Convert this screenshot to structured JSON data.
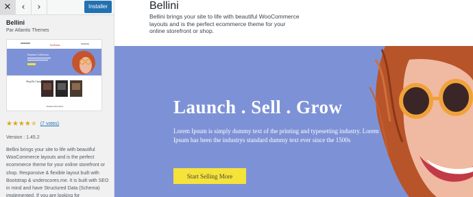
{
  "sidebar": {
    "close_icon": "close-icon",
    "prev_icon": "chevron-left-icon",
    "next_icon": "chevron-right-icon",
    "install_label": "Installer",
    "theme_name": "Bellini",
    "theme_author": "Par Atlantis Themes",
    "thumbnail": {
      "brand": "Azeleena",
      "hero_title": "Summer Collection",
      "category_title": "Shop By Category",
      "featured_title": "Featured Products"
    },
    "rating": {
      "stars": 4.5,
      "votes_label": "(7 votes)"
    },
    "version_label": "Version : 1.45.2",
    "description": "Bellini brings your site to life with beautiful WooCommerce layouts and is the perfect ecommerce theme for your online storefront or shop. Responsive & flexible layout built with Bootstrap & underscores.me. It is built with SEO in mind and have Structured Data (Schema) implemented. If you are looking for"
  },
  "preview": {
    "title": "Bellini",
    "description": "Bellini brings your site to life with beautiful WooCommerce layouts and is the perfect ecommerce theme for your online storefront or shop.",
    "hero": {
      "headline": "Launch . Sell . Grow",
      "subtext": "Lorem Ipsum is simply dummy text of the printing and typesetting industry. Lorem Ipsum has been the industrys standard dummy text ever since the 1500s",
      "button_label": "Start Selling More",
      "background_color": "#7d92d6",
      "button_color": "#f6e33a"
    }
  },
  "colors": {
    "accent": "#2271b1",
    "star": "#dba617"
  }
}
